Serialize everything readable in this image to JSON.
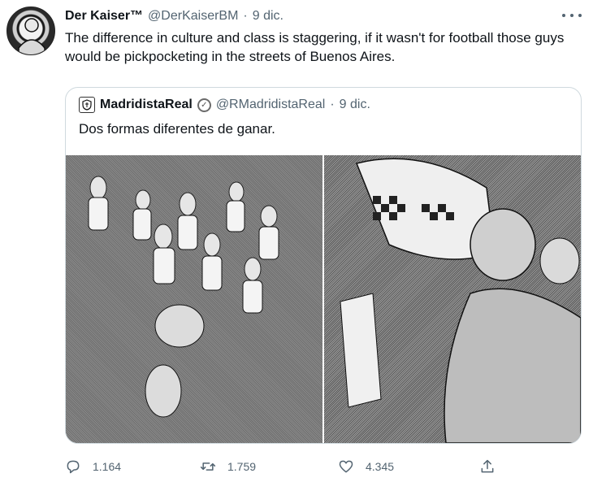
{
  "tweet": {
    "author_name": "Der Kaiser™",
    "author_handle": "@DerKaiserBM",
    "separator": "·",
    "date": "9 dic.",
    "text": "The difference in culture and class is staggering, if it wasn't for football those guys would be pickpocketing in the streets of Buenos Aires."
  },
  "quote": {
    "author_name": "MadridistaReal",
    "author_handle": "@RMadridistaReal",
    "separator": "·",
    "date": "9 dic.",
    "text": "Dos formas diferentes de ganar."
  },
  "actions": {
    "reply_count": "1.164",
    "retweet_count": "1.759",
    "like_count": "4.345"
  },
  "icons": {
    "reply": "reply-icon",
    "retweet": "retweet-icon",
    "like": "heart-icon",
    "share": "share-icon",
    "more": "more-icon",
    "verified": "verified-icon"
  }
}
